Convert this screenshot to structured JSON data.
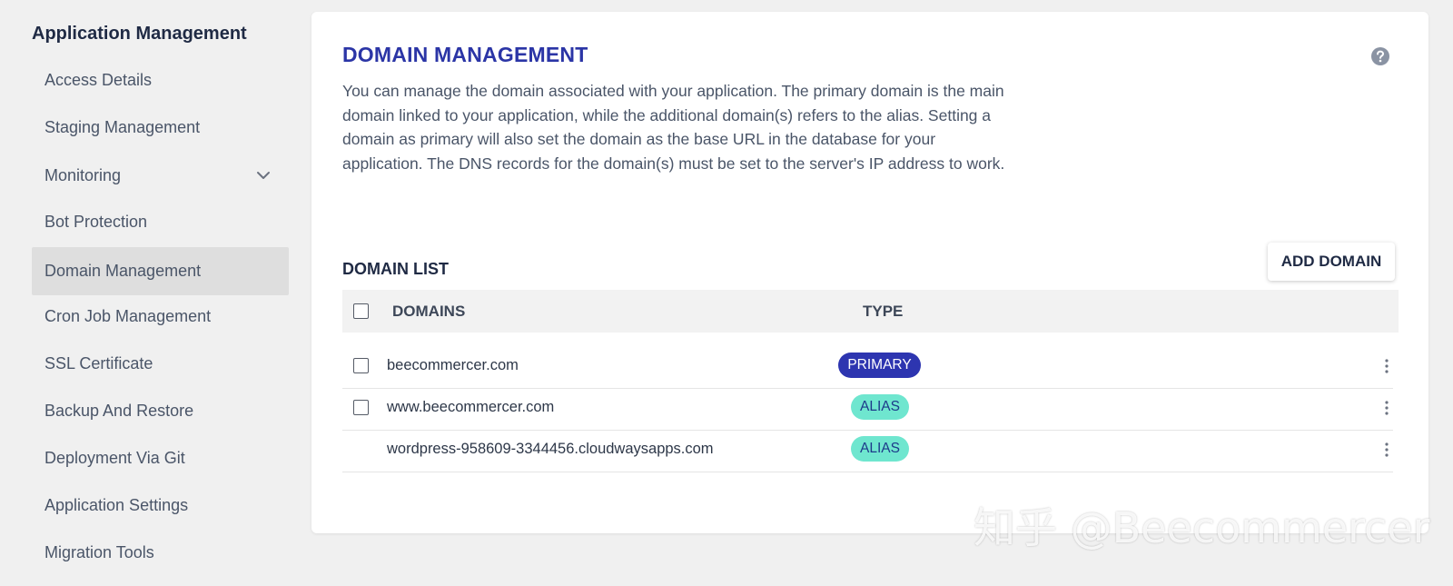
{
  "sidebar": {
    "title": "Application Management",
    "items": [
      {
        "label": "Access Details"
      },
      {
        "label": "Staging Management"
      },
      {
        "label": "Monitoring"
      },
      {
        "label": "Bot Protection"
      },
      {
        "label": "Domain Management"
      },
      {
        "label": "Cron Job Management"
      },
      {
        "label": "SSL Certificate"
      },
      {
        "label": "Backup And Restore"
      },
      {
        "label": "Deployment Via Git"
      },
      {
        "label": "Application Settings"
      },
      {
        "label": "Migration Tools"
      }
    ],
    "active_index": 4
  },
  "main": {
    "title": "DOMAIN MANAGEMENT",
    "description": "You can manage the domain associated with your application. The primary domain is the main domain linked to your application, while the additional domain(s) refers to the alias. Setting a domain as primary will also set the domain as the base URL in the database for your application. The DNS records for the domain(s) must be set to the server's IP address to work.",
    "list_title": "DOMAIN LIST",
    "add_button": "ADD DOMAIN",
    "columns": {
      "domains": "DOMAINS",
      "type": "TYPE"
    },
    "rows": [
      {
        "domain": "beecommercer.com",
        "type": "PRIMARY",
        "checkbox": true
      },
      {
        "domain": "www.beecommercer.com",
        "type": "ALIAS",
        "checkbox": true
      },
      {
        "domain": "wordpress-958609-3344456.cloudwaysapps.com",
        "type": "ALIAS",
        "checkbox": false
      }
    ]
  },
  "watermark": "知乎 @Beecommercer",
  "icons": {
    "help": "question-circle-icon",
    "chevron": "chevron-down-icon",
    "kebab": "more-vertical-icon"
  },
  "colors": {
    "title_blue": "#2b35a6",
    "primary_badge": "#2d35b0",
    "alias_badge": "#6fe6cf",
    "active_nav": "#dedede"
  }
}
